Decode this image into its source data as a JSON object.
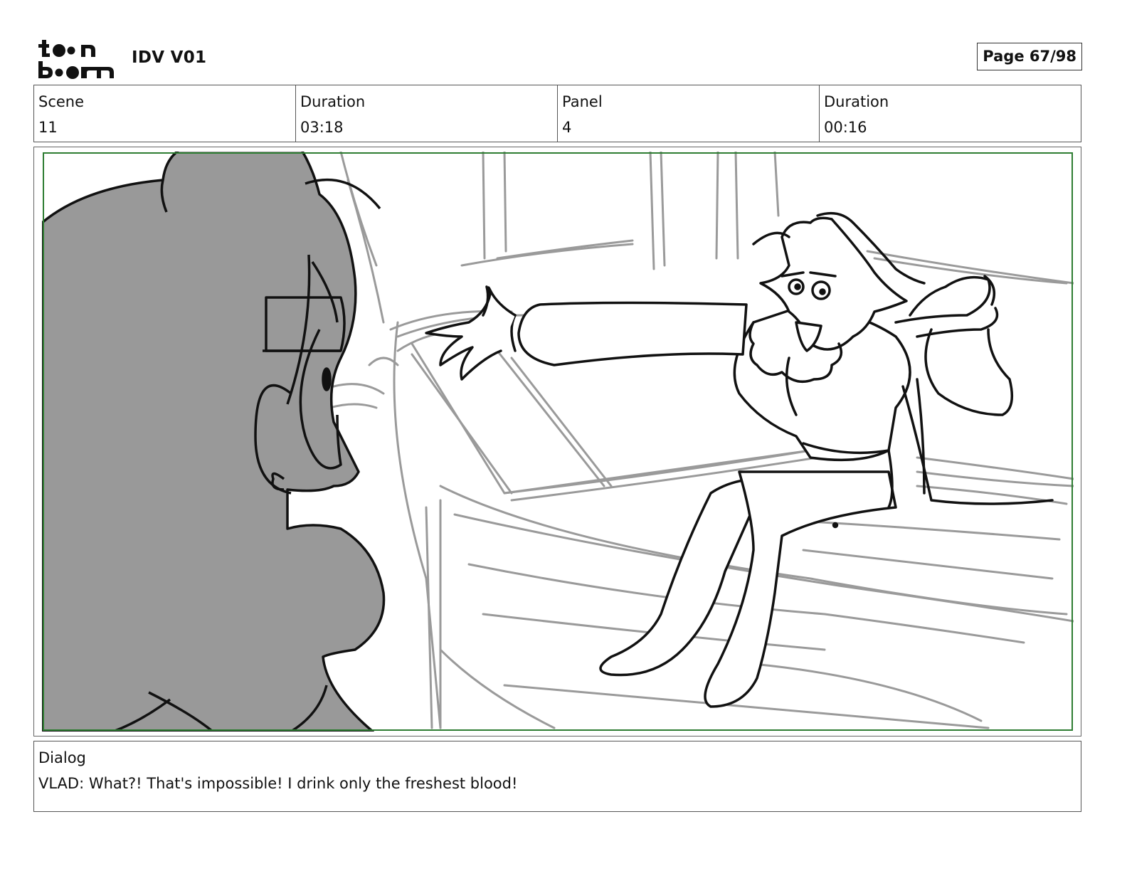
{
  "header": {
    "logo_text": "toon boom",
    "project_title": "IDV V01",
    "page_label": "Page 67/98"
  },
  "info": {
    "scene_label": "Scene",
    "scene_value": "11",
    "scene_duration_label": "Duration",
    "scene_duration_value": "03:18",
    "panel_label": "Panel",
    "panel_value": "4",
    "panel_duration_label": "Duration",
    "panel_duration_value": "00:16"
  },
  "dialog": {
    "label": "Dialog",
    "text": "VLAD: What?! That's impossible! I drink only the freshest blood!"
  },
  "colors": {
    "safe_frame": "#2e7d32",
    "silhouette": "#999999",
    "sketch_rough": "#9a9a9a",
    "ink": "#111111"
  }
}
